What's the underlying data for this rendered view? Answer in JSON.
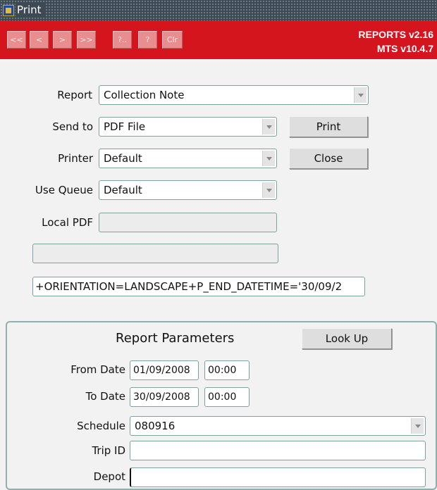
{
  "window": {
    "title": "Print"
  },
  "toolbar": {
    "buttons": [
      {
        "label": "<<",
        "icon": "first-record-icon"
      },
      {
        "label": "<",
        "icon": "previous-record-icon"
      },
      {
        "label": ">",
        "icon": "next-record-icon"
      },
      {
        "label": ">>",
        "icon": "last-record-icon"
      },
      {
        "label": "?..",
        "icon": "list-values-icon"
      },
      {
        "label": "?",
        "icon": "help-icon"
      },
      {
        "label": "Clr",
        "icon": "clear-icon"
      }
    ],
    "version_reports": "REPORTS v2.16",
    "version_mts": "MTS v10.4.7",
    "colors": {
      "toolbar": "#d5151d",
      "titlebar": "#3d4954"
    }
  },
  "form": {
    "report": {
      "label": "Report",
      "value": "Collection Note"
    },
    "send_to": {
      "label": "Send to",
      "value": "PDF File"
    },
    "printer": {
      "label": "Printer",
      "value": "Default"
    },
    "use_queue": {
      "label": "Use Queue",
      "value": "Default"
    },
    "local_pdf": {
      "label": "Local PDF",
      "value": ""
    },
    "blank_field": {
      "value": ""
    },
    "param_string": {
      "value": "+ORIENTATION=LANDSCAPE+P_END_DATETIME='30/09/2"
    },
    "print_button": "Print",
    "close_button": "Close"
  },
  "parameters": {
    "title": "Report Parameters",
    "lookup_button": "Look Up",
    "from_date": {
      "label": "From Date",
      "date": "01/09/2008",
      "time": "00:00"
    },
    "to_date": {
      "label": "To Date",
      "date": "30/09/2008",
      "time": "00:00"
    },
    "schedule": {
      "label": "Schedule",
      "value": "080916"
    },
    "trip_id": {
      "label": "Trip ID",
      "value": ""
    },
    "depot": {
      "label": "Depot",
      "value": ""
    }
  }
}
